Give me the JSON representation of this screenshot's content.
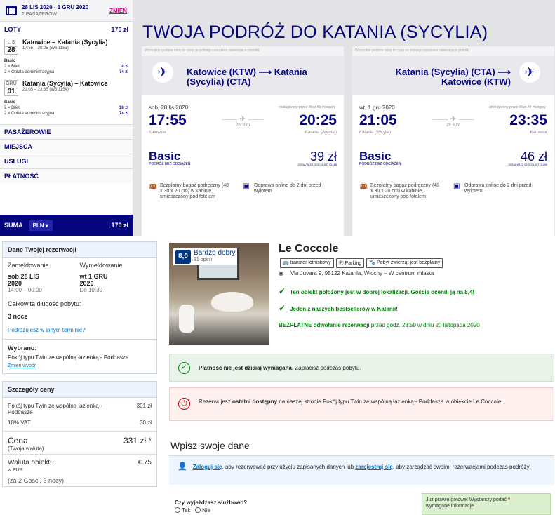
{
  "wizz": {
    "header": {
      "dates": "28 LIS 2020 - 1 GRU 2020",
      "pax": "2 PASAŻERÓW",
      "change": "ZMIEŃ"
    },
    "flights_label": "LOTY",
    "flights_total": "170 zł",
    "flight1": {
      "month": "LIS",
      "day": "28",
      "route": "Katowice – Katania (Sycylia)",
      "time": "17:55 – 20:25 (W6 1153)",
      "fare": "Basic",
      "lines": [
        {
          "l": "2 × Bilet",
          "v": "4 zł"
        },
        {
          "l": "2 × Opłata administracyjna",
          "v": "74 zł"
        }
      ]
    },
    "flight2": {
      "month": "GRU",
      "day": "01",
      "route": "Katania (Sycylia) – Katowice",
      "time": "21:05 – 23:35 (W6 1154)",
      "fare": "Basic",
      "lines": [
        {
          "l": "2 × Bilet",
          "v": "18 zł"
        },
        {
          "l": "2 × Opłata administracyjna",
          "v": "74 zł"
        }
      ]
    },
    "sections": [
      "PASAŻEROWIE",
      "MIEJSCA",
      "USŁUGI",
      "PŁATNOŚĆ"
    ],
    "sum_label": "SUMA",
    "currency": "PLN",
    "sum_total": "170 zł",
    "title": "TWOJA PODRÓŻ DO KATANIA (SYCYLIA)",
    "note": "Wszystkie podane ceny to ceny za jednego pasażera zawierające podatki.",
    "cards": [
      {
        "route": "Katowice (KTW) ⟶ Katania (Sycylia) (CTA)",
        "date": "sob, 28 lis 2020",
        "operated": "obsługiwany przez Wizz Air Hungary",
        "dep": "17:55",
        "arr": "20:25",
        "dur": "2h 30m",
        "from": "Katowice",
        "to": "Katania (Sycylia)",
        "fare": "Basic",
        "fare_sub": "PODRÓŻ BEZ OBCIĄŻEŃ",
        "price": "39 zł",
        "price_sub": "CENA WIZZ DISCOUNT CLUB",
        "bag": "Bezpłatny bagaż podręczny (40 x 30 x 20 cm) w kabinie, umieszczony pod fotelem",
        "checkin": "Odprawa online do 2 dni przed wylotem"
      },
      {
        "route": "Katania (Sycylia) (CTA) ⟶ Katowice (KTW)",
        "date": "wt, 1 gru 2020",
        "operated": "obsługiwany przez Wizz Air Hungary",
        "dep": "21:05",
        "arr": "23:35",
        "dur": "2h 30m",
        "from": "Katania (Sycylia)",
        "to": "Katowice",
        "fare": "Basic",
        "fare_sub": "PODRÓŻ BEZ OBCIĄŻEŃ",
        "price": "46 zł",
        "price_sub": "CENA WIZZ DISCOUNT CLUB",
        "bag": "Bezpłatny bagaż podręczny (40 x 30 x 20 cm) w kabinie, umieszczony pod fotelem",
        "checkin": "Odprawa online do 2 dni przed wylotem"
      }
    ]
  },
  "booking": {
    "details_title": "Dane Twojej rezerwacji",
    "checkin_label": "Zameldowanie",
    "checkout_label": "Wymeldowanie",
    "checkin_date": "sob 28 LIS 2020",
    "checkout_date": "wt 1 GRU 2020",
    "checkin_time": "14:00 – 00:00",
    "checkout_time": "Do 10:30",
    "length_label": "Całkowita długość pobytu:",
    "length_val": "3 noce",
    "travel_other": "Podróżujesz w innym terminie?",
    "chosen_label": "Wybrano:",
    "chosen_val": "Pokój typu Twin ze wspólną łazienką - Poddasze",
    "change_choice": "Zmień wybór",
    "price_title": "Szczegóły ceny",
    "price_rows": [
      {
        "l": "Pokój typu Twin ze wspólną łazienką - Poddasze",
        "v": "301 zł"
      },
      {
        "l": "10% VAT",
        "v": "30 zł"
      }
    ],
    "price_label": "Cena",
    "price_sub": "(Twoja waluta)",
    "price_val": "331 zł *",
    "prop_cur_label": "Waluta obiektu",
    "prop_cur_sub": "w EUR",
    "prop_cur_val": "€ 75",
    "guests_note": "(za 2 Gości, 3 nocy)",
    "score": "8,0",
    "score_label": "Bardzo dobry",
    "reviews": "81 opinii",
    "hotel_name": "Le Coccole",
    "tags": [
      "transfer lotniskowy",
      "Parking",
      "Pobyt zwierząt jest bezpłatny"
    ],
    "address": "Via Juvara 9, 95122 Katania, Włochy – W centrum miasta",
    "good1": "Ten obiekt położony jest w dobrej lokalizacji. Goście ocenili ją na 8,4!",
    "good2": "Jeden z naszych bestsellerów w Katanii!",
    "free_cancel": "BEZPŁATNE odwołanie rezerwacji",
    "free_cancel_until": "przed godz. 23:59 w dniu 20 listopada 2020",
    "pay_bold": "Płatność nie jest dzisiaj wymagana.",
    "pay_rest": " Zapłacisz podczas pobytu.",
    "warn_a": "Rezerwujesz ",
    "warn_bold": "ostatni dostępny",
    "warn_b": " na naszej stronie Pokój typu Twin ze wspólną łazienką - Poddasze w obiekcie Le Coccole.",
    "enter_data": "Wpisz swoje dane",
    "sign_login": "Zaloguj się",
    "sign_a": ", aby rezerwować przy użyciu zapisanych danych lub ",
    "sign_register": "zarejestruj się",
    "sign_b": ", aby zarządzać swoimi rezerwacjami podczas podróży!",
    "business_q": "Czy wyjeżdżasz służbowo?",
    "yes": "Tak",
    "no": "Nie",
    "almost": "Już prawie gotowe! Wystarczy podać",
    "almost2": "wymagane informacje"
  }
}
